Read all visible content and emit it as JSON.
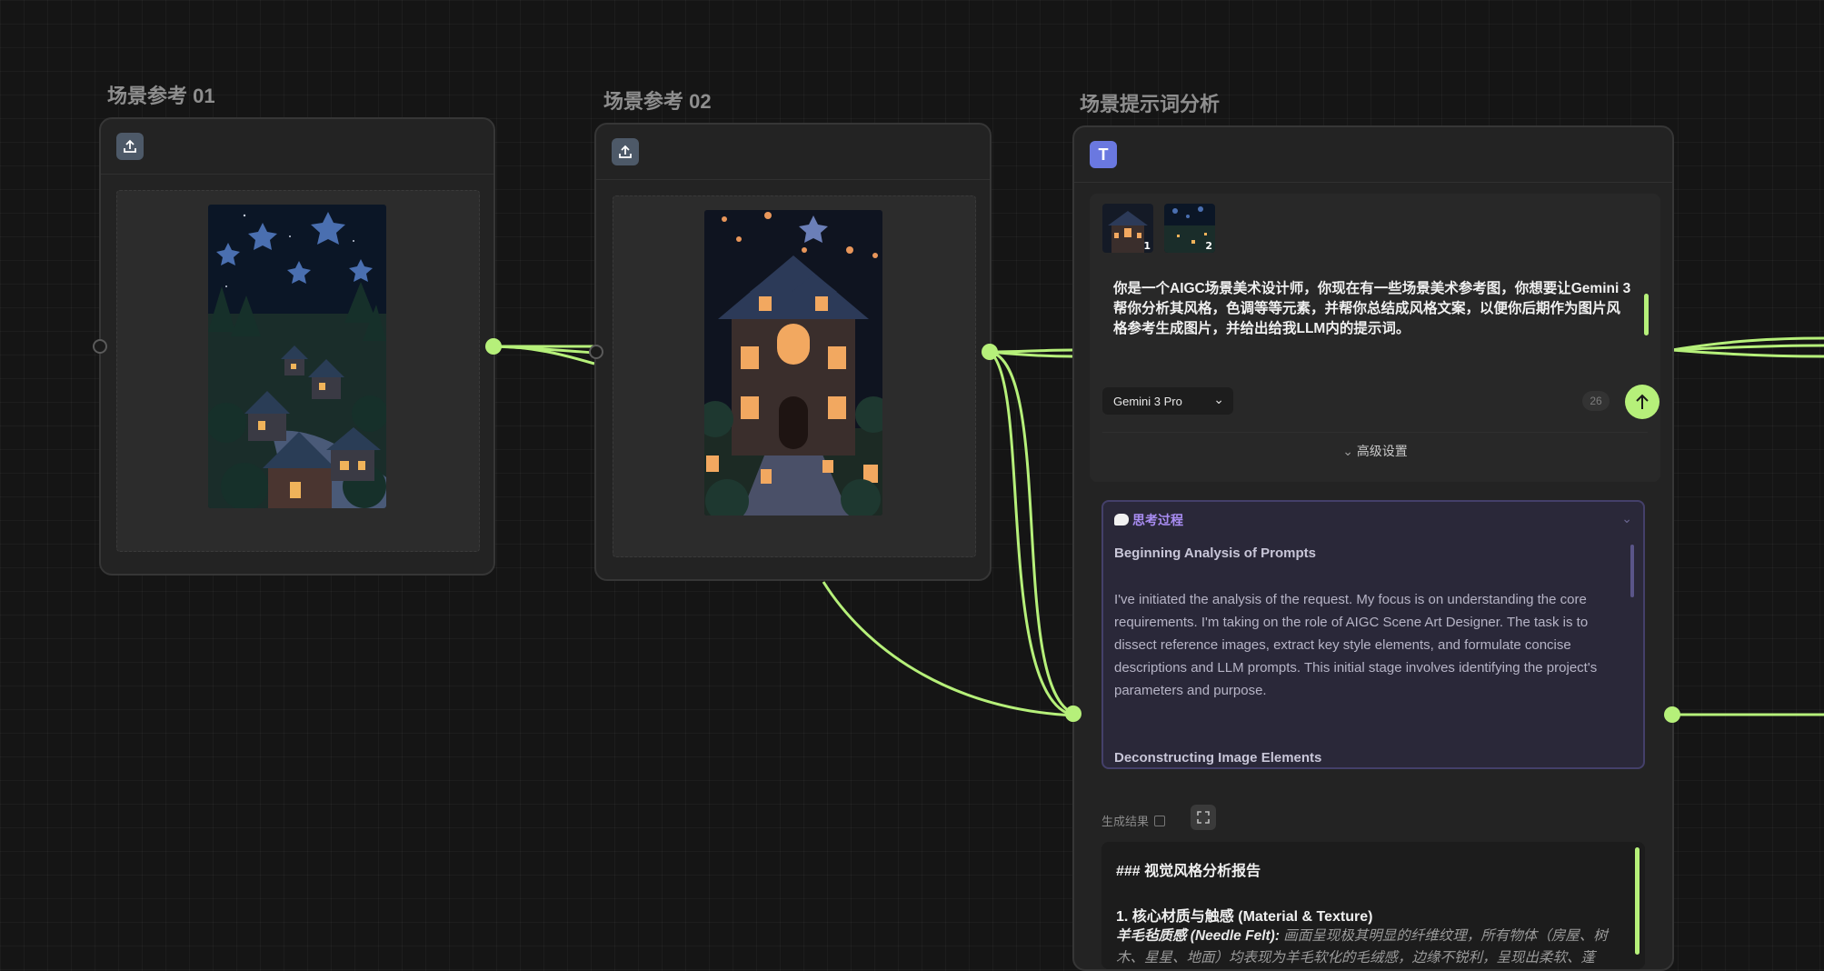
{
  "nodes": {
    "ref1": {
      "title": "场景参考 01",
      "upload_icon": "upload-icon"
    },
    "ref2": {
      "title": "场景参考 02",
      "upload_icon": "upload-icon"
    },
    "analysis": {
      "title": "场景提示词分析",
      "badge": "T",
      "attachments": [
        {
          "index": "1",
          "thumb": "house-thumb"
        },
        {
          "index": "2",
          "thumb": "village-thumb"
        }
      ],
      "prompt": "你是一个AIGC场景美术设计师，你现在有一些场景美术参考图，你想要让Gemini 3 帮你分析其风格，色调等等元素，并帮你总结成风格文案，以便你后期作为图片风格参考生成图片，并给出给我LLM内的提示词。",
      "model": "Gemini 3 Pro",
      "count": "26",
      "advanced_label": "高级设置",
      "thinking": {
        "label": "思考过程",
        "heading1": "Beginning Analysis of Prompts",
        "paragraph": "I've initiated the analysis of the request. My focus is on understanding the core requirements. I'm taking on the role of AIGC Scene Art Designer. The task is to dissect reference images, extract key style elements, and formulate concise descriptions and LLM prompts. This initial stage involves identifying the project's parameters and purpose.",
        "heading2": "Deconstructing Image Elements"
      },
      "result": {
        "label": "生成结果",
        "line1": "### 视觉风格分析报告",
        "line2": "1. 核心材质与触感 (Material & Texture)",
        "line3_bold": "羊毛毡质感 (Needle Felt):",
        "line3_rest": " 画面呈现极其明显的纤维纹理，所有物体（房屋、树木、星星、地面）均表现为羊毛软化的毛绒感，边缘不锐利，呈现出柔软、蓬"
      }
    }
  },
  "colors": {
    "accent_green": "#b6f07a",
    "badge_purple": "#6a78e0",
    "thinking_purple": "#a98df3"
  }
}
